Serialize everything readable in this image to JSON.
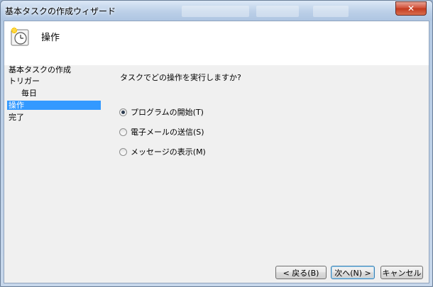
{
  "window": {
    "title": "基本タスクの作成ウィザード",
    "close_glyph": "✕"
  },
  "header": {
    "title": "操作",
    "icon": "clock-icon"
  },
  "nav": {
    "items": [
      {
        "label": "基本タスクの作成"
      },
      {
        "label": "トリガー"
      },
      {
        "label": "毎日"
      },
      {
        "label": "操作"
      },
      {
        "label": "完了"
      }
    ]
  },
  "main": {
    "question": "タスクでどの操作を実行しますか?",
    "options": [
      {
        "label": "プログラムの開始(T)",
        "checked": true
      },
      {
        "label": "電子メールの送信(S)",
        "checked": false
      },
      {
        "label": "メッセージの表示(M)",
        "checked": false
      }
    ]
  },
  "buttons": {
    "back": "< 戻る(B)",
    "next": "次へ(N) >",
    "cancel": "キャンセル"
  },
  "colors": {
    "selection": "#3399ff",
    "close": "#c33a1f"
  }
}
